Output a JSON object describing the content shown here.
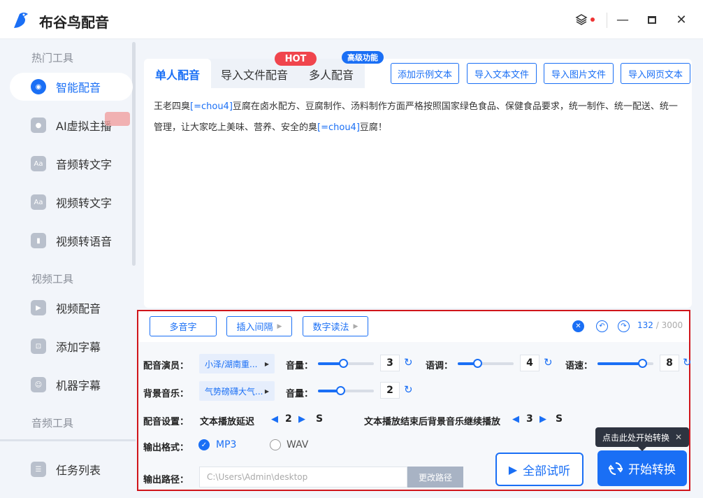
{
  "app": {
    "title": "布谷鸟配音"
  },
  "sidebar": {
    "groups": [
      {
        "label": "热门工具"
      },
      {
        "label": "视频工具"
      },
      {
        "label": "音频工具"
      }
    ],
    "items": [
      {
        "label": "智能配音",
        "icon": "voice-icon"
      },
      {
        "label": "AI虚拟主播",
        "icon": "avatar-icon"
      },
      {
        "label": "音频转文字",
        "icon": "audio-text-icon"
      },
      {
        "label": "视频转文字",
        "icon": "video-text-icon"
      },
      {
        "label": "视频转语音",
        "icon": "video-voice-icon"
      },
      {
        "label": "视频配音",
        "icon": "video-dub-icon"
      },
      {
        "label": "添加字幕",
        "icon": "subtitle-icon"
      },
      {
        "label": "机器字幕",
        "icon": "robot-icon"
      },
      {
        "label": "任务列表",
        "icon": "task-list-icon"
      }
    ]
  },
  "tabs": [
    {
      "label": "单人配音"
    },
    {
      "label": "导入文件配音"
    },
    {
      "label": "多人配音"
    }
  ],
  "badges": {
    "hot": "HOT",
    "advanced": "高级功能"
  },
  "toolbar": {
    "add_sample": "添加示例文本",
    "import_text": "导入文本文件",
    "import_image": "导入图片文件",
    "import_web": "导入网页文本"
  },
  "editor": {
    "p1": "王老四臭",
    "pin1": "[=chou4]",
    "p2": "豆腐在卤水配方、豆腐制作、汤料制作方面严格按照国家绿色食品、保健食品要求，统一制作、统一配送、统一管理，让大家吃上美味、营养、安全的臭",
    "pin2": "[=chou4]",
    "p3": "豆腐！"
  },
  "edit_tools": {
    "polyphone": "多音字",
    "insert_pause": "插入间隔",
    "number_reading": "数字读法",
    "count": "132",
    "max": "/ 3000"
  },
  "settings": {
    "voice_label": "配音演员：",
    "voice_value": "小泽/湖南重...",
    "volume_label": "音量：",
    "volume_value": "3",
    "volume_level": 0.45,
    "tone_label": "语调：",
    "tone_value": "4",
    "tone_level": 0.35,
    "speed_label": "语速：",
    "speed_value": "8",
    "speed_level": 0.8,
    "bgm_label": "背景音乐：",
    "bgm_value": "气势磅礴大气...",
    "bgm_volume_label": "音量：",
    "bgm_volume_value": "2",
    "bgm_volume_level": 0.4,
    "config_label": "配音设置：",
    "delay_label": "文本播放延迟",
    "delay_value": "2",
    "delay_unit": "S",
    "bgm_continue_label": "文本播放结束后背景音乐继续播放",
    "bgm_continue_value": "3",
    "bgm_continue_unit": "S",
    "format_label": "输出格式：",
    "format_mp3": "MP3",
    "format_wav": "WAV",
    "path_label": "输出路径：",
    "path_value": "C:\\Users\\Admin\\desktop",
    "change_path": "更改路径"
  },
  "actions": {
    "preview_all": "全部试听",
    "start_convert": "开始转换",
    "tooltip": "点击此处开始转换"
  },
  "colors": {
    "accent": "#1a6ff5",
    "hot": "#f0454d",
    "frame": "#d0151b"
  }
}
